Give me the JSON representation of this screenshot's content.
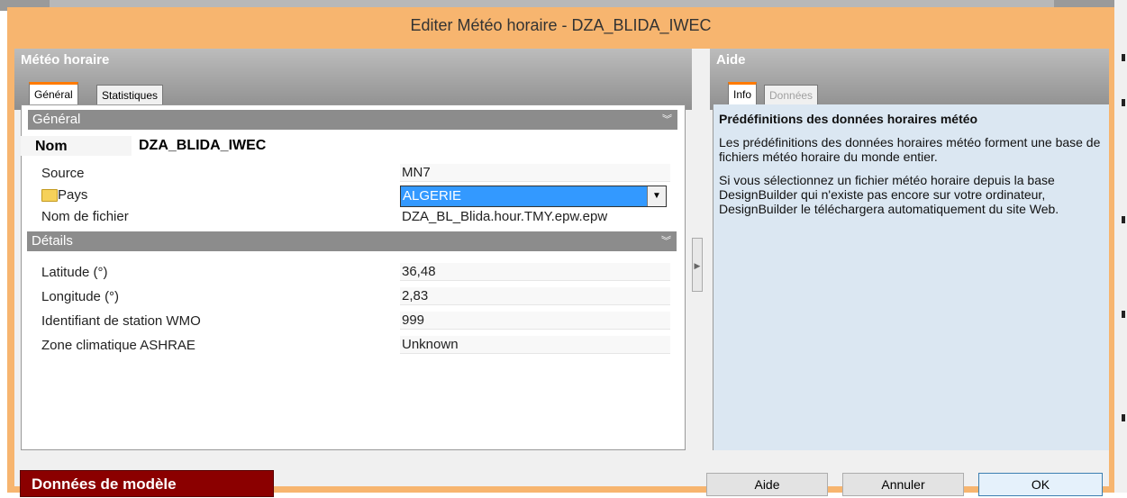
{
  "dialog": {
    "title": "Editer Météo horaire -  DZA_BLIDA_IWEC"
  },
  "left_panel": {
    "title": "Météo horaire",
    "tabs": [
      {
        "label": "Général",
        "active": true
      },
      {
        "label": "Statistiques",
        "active": false
      }
    ],
    "sections": [
      {
        "header": "Général",
        "fields": {
          "nom": {
            "label": "Nom",
            "value": "DZA_BLIDA_IWEC"
          },
          "source": {
            "label": "Source",
            "value": "MN7"
          },
          "pays": {
            "label": "Pays",
            "value": "ALGERIE"
          },
          "fichier": {
            "label": "Nom de fichier",
            "value": "DZA_BL_Blida.hour.TMY.epw.epw"
          }
        }
      },
      {
        "header": "Détails",
        "fields": {
          "latitude": {
            "label": "Latitude (°)",
            "value": "36,48"
          },
          "longitude": {
            "label": "Longitude (°)",
            "value": "2,83"
          },
          "wmo": {
            "label": "Identifiant de station WMO",
            "value": "999"
          },
          "ashrae": {
            "label": "Zone climatique ASHRAE",
            "value": "Unknown"
          }
        }
      }
    ]
  },
  "right_panel": {
    "title": "Aide",
    "tabs": [
      {
        "label": "Info",
        "active": true
      },
      {
        "label": "Données",
        "active": false
      }
    ],
    "help_title": "Prédéfinitions des données horaires météo",
    "paragraphs": [
      "Les prédéfinitions des données horaires météo forment une base de fichiers météo horaire du monde entier.",
      "Si vous sélectionnez un fichier météo horaire depuis la base DesignBuilder qui n'existe pas encore sur votre ordinateur, DesignBuilder le téléchargera automatiquement du site Web."
    ]
  },
  "bottom_bar": {
    "model_data_label": "Données de modèle",
    "help_button": "Aide",
    "cancel_button": "Annuler",
    "ok_button": "OK"
  },
  "colors": {
    "title_bar": "#f7b56f",
    "tab_accent": "#ff7a00",
    "selection": "#3399ff",
    "model_badge": "#8b0000",
    "help_background": "#dbe7f2"
  }
}
